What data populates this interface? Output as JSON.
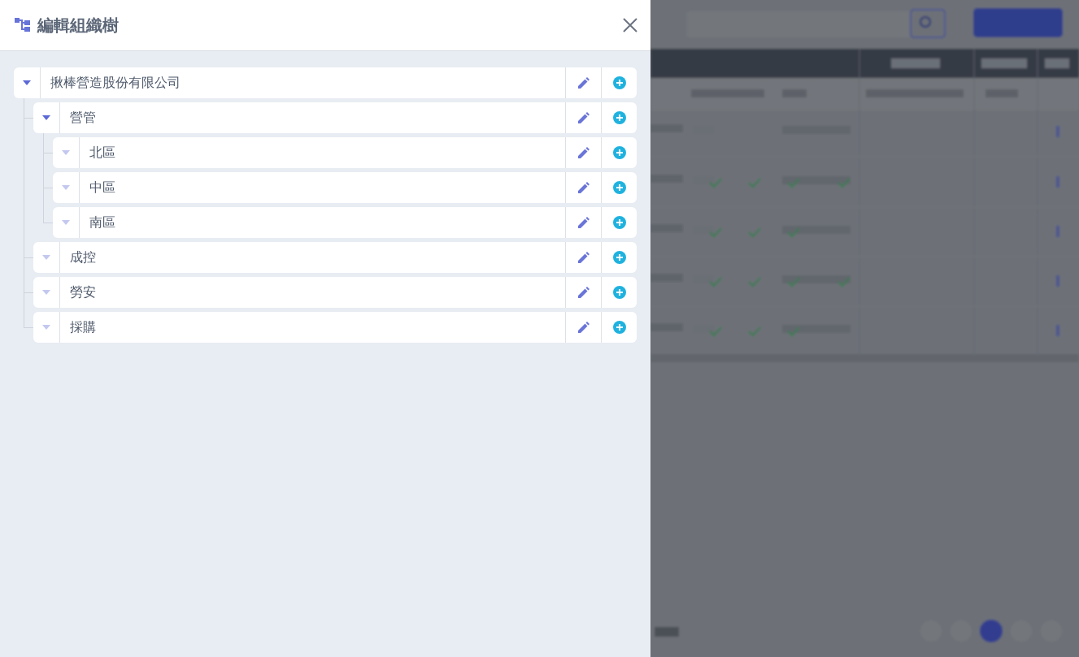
{
  "dialog": {
    "title": "編輯組織樹"
  },
  "tree": [
    {
      "label": "揪棒營造股份有限公司",
      "expanded": true,
      "children": [
        {
          "label": "營管",
          "expanded": true,
          "children": [
            {
              "label": "北區",
              "expanded": false
            },
            {
              "label": "中區",
              "expanded": false
            },
            {
              "label": "南區",
              "expanded": false
            }
          ]
        },
        {
          "label": "成控",
          "expanded": false
        },
        {
          "label": "勞安",
          "expanded": false
        },
        {
          "label": "採購",
          "expanded": false
        }
      ]
    }
  ]
}
